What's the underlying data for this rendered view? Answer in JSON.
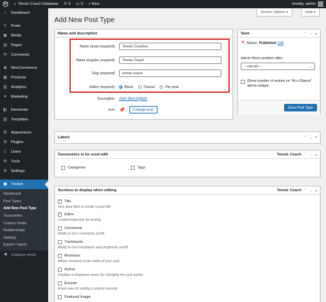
{
  "adminbar": {
    "site_name": "Tennis Coach Database",
    "updates_count": "3",
    "comments_count": "0",
    "new_label": "+ New",
    "greeting": "Howdy, admin"
  },
  "sidebar": {
    "items": [
      {
        "label": "Dashboard",
        "icon": "⌂"
      },
      {
        "label": "Posts",
        "icon": "✎"
      },
      {
        "label": "Media",
        "icon": "▣"
      },
      {
        "label": "Pages",
        "icon": "▤"
      },
      {
        "label": "Comments",
        "icon": "✉"
      },
      {
        "label": "WooCommerce",
        "icon": "◉"
      },
      {
        "label": "Products",
        "icon": "▦"
      },
      {
        "label": "Analytics",
        "icon": "▥"
      },
      {
        "label": "Marketing",
        "icon": "✦"
      },
      {
        "label": "Elementor",
        "icon": "◧"
      },
      {
        "label": "Templates",
        "icon": "▧"
      },
      {
        "label": "Appearance",
        "icon": "✿"
      },
      {
        "label": "Plugins",
        "icon": "⚙"
      },
      {
        "label": "Users",
        "icon": "☺"
      },
      {
        "label": "Tools",
        "icon": "⚒"
      },
      {
        "label": "Settings",
        "icon": "⚙"
      },
      {
        "label": "Toolset",
        "icon": "▣"
      }
    ],
    "submenu": [
      "Dashboard",
      "Post Types",
      "Add New Post Type",
      "Taxonomies",
      "Custom Fields",
      "Relationships",
      "Settings",
      "Export / Import"
    ],
    "collapse_label": "Collapse menu"
  },
  "header": {
    "screen_options": "Screen Options ▾",
    "help": "Help ▾",
    "title": "Add New Post Type"
  },
  "name_box": {
    "title": "Name and description",
    "plural_label": "Name plural (required)",
    "plural_value": "Tennis Coaches",
    "singular_label": "Name singular (required)",
    "singular_value": "Tennis Coach",
    "slug_label": "Slug (required)",
    "slug_value": "tennis-coach",
    "editor_label": "Editor (required)",
    "editor_options": [
      "Block",
      "Classic",
      "Per post"
    ],
    "description_label": "Description",
    "add_description": "Add description",
    "icon_label": "Icon",
    "change_icon": "Change icon"
  },
  "save_box": {
    "title": "Save",
    "status_label": "Status:",
    "status_value": "Published",
    "status_edit": "Edit",
    "menu_position_label": "Admin Menu position after:",
    "menu_position_value": "-- not set --",
    "glance_label": "Show number of entries on \"At a Glance\" admin widget.",
    "save_button": "Save Post Type"
  },
  "labels_box": {
    "title": "Labels"
  },
  "taxonomies_box": {
    "title": "Taxonomies to be used with",
    "context": "Tennis Coach",
    "options": [
      "Categories",
      "Tags"
    ]
  },
  "sections_box": {
    "title": "Sections to display when editing",
    "context": "Tennis Coach",
    "items": [
      {
        "label": "Title",
        "checked": true,
        "desc": "Text input field to create a post title."
      },
      {
        "label": "Editor",
        "checked": true,
        "desc": "Content input box for writing."
      },
      {
        "label": "Comments",
        "checked": false,
        "desc": "Ability to turn comments on/off."
      },
      {
        "label": "Trackbacks",
        "checked": false,
        "desc": "Ability to turn trackbacks and pingbacks on/off."
      },
      {
        "label": "Revisions",
        "checked": false,
        "desc": "Allows revisions to be made of your post."
      },
      {
        "label": "Author",
        "checked": false,
        "desc": "Displays a dropdown menu for changing the post author."
      },
      {
        "label": "Excerpt",
        "checked": false,
        "desc": "A text area for writing a custom excerpt."
      },
      {
        "label": "Featured Image",
        "checked": false,
        "desc": ""
      }
    ]
  }
}
